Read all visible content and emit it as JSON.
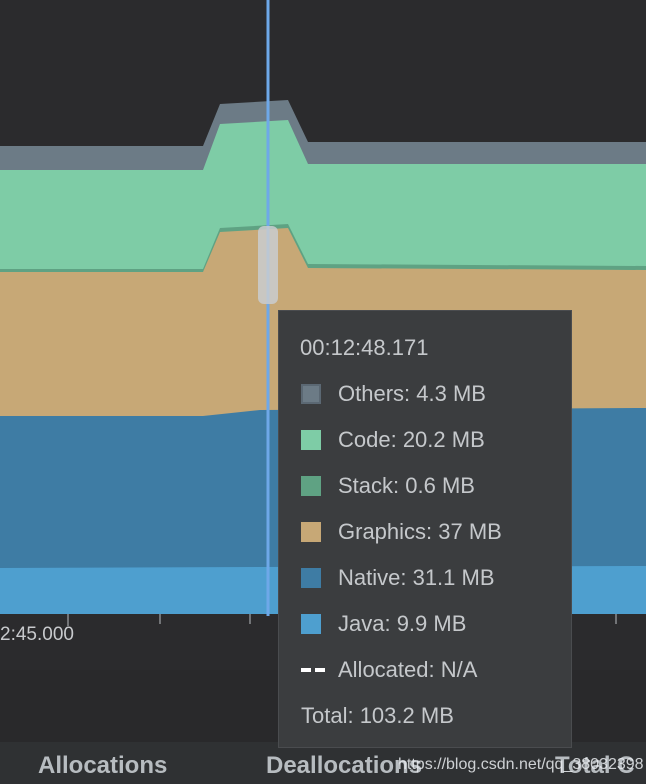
{
  "chart_data": {
    "type": "area",
    "stacked": true,
    "series": [
      {
        "name": "Java",
        "color": "#4e9fcf",
        "values": [
          9.9,
          9.9
        ]
      },
      {
        "name": "Native",
        "color": "#3e7ca4",
        "values": [
          31.1,
          31.1
        ]
      },
      {
        "name": "Graphics",
        "color": "#c7a876",
        "values": [
          37,
          37
        ]
      },
      {
        "name": "Stack",
        "color": "#5fa283",
        "values": [
          0.6,
          0.6
        ]
      },
      {
        "name": "Code",
        "color": "#7ecca6",
        "values": [
          20.2,
          20.2
        ]
      },
      {
        "name": "Others",
        "color": "#6c7b86",
        "values": [
          4.3,
          4.3
        ]
      }
    ],
    "x_tick_label": "2:45.000",
    "legend": "tooltip"
  },
  "tooltip": {
    "time": "00:12:48.171",
    "rows": [
      {
        "label": "Others: 4.3 MB",
        "color": "#6c7b86"
      },
      {
        "label": "Code: 20.2 MB",
        "color": "#7ecca6"
      },
      {
        "label": "Stack: 0.6 MB",
        "color": "#5fa283"
      },
      {
        "label": "Graphics: 37 MB",
        "color": "#c7a876"
      },
      {
        "label": "Native: 31.1 MB",
        "color": "#3e7ca4"
      },
      {
        "label": "Java: 9.9 MB",
        "color": "#4e9fcf"
      }
    ],
    "allocated": "Allocated: N/A",
    "total": "Total: 103.2 MB"
  },
  "columns": {
    "allocations": "Allocations",
    "deallocations": "Deallocations",
    "total": "Total C"
  },
  "watermark": "https://blog.csdn.net/qq_38032398"
}
